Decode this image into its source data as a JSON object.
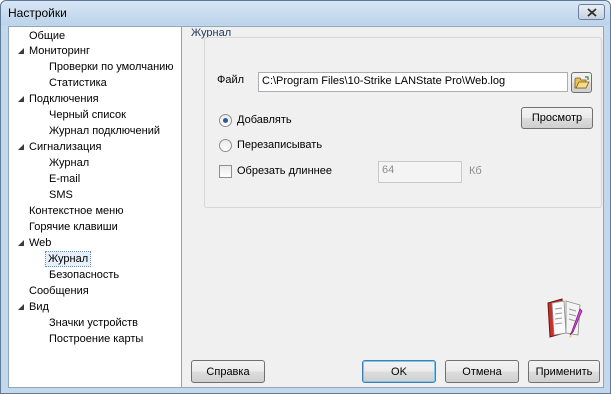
{
  "window": {
    "title": "Настройки"
  },
  "tree": {
    "items": [
      {
        "label": "Общие"
      },
      {
        "label": "Мониторинг"
      },
      {
        "label": "Проверки по умолчанию"
      },
      {
        "label": "Статистика"
      },
      {
        "label": "Подключения"
      },
      {
        "label": "Черный список"
      },
      {
        "label": "Журнал подключений"
      },
      {
        "label": "Сигнализация"
      },
      {
        "label": "Журнал"
      },
      {
        "label": "E-mail"
      },
      {
        "label": "SMS"
      },
      {
        "label": "Контекстное меню"
      },
      {
        "label": "Горячие клавиши"
      },
      {
        "label": "Web"
      },
      {
        "label": "Журнал"
      },
      {
        "label": "Безопасность"
      },
      {
        "label": "Сообщения"
      },
      {
        "label": "Вид"
      },
      {
        "label": "Значки устройств"
      },
      {
        "label": "Построение карты"
      }
    ]
  },
  "panel": {
    "title": "Журнал",
    "file_label": "Файл",
    "file_value": "C:\\Program Files\\10-Strike LANState Pro\\Web.log",
    "append_label": "Добавлять",
    "overwrite_label": "Перезаписывать",
    "truncate_label": "Обрезать длиннее",
    "truncate_value": "64",
    "truncate_unit": "Кб",
    "view_button": "Просмотр",
    "selected_mode": "append",
    "truncate_checked": false
  },
  "footer": {
    "help_button": "Справка",
    "ok_button": "OK",
    "cancel_button": "Отмена",
    "apply_button": "Применить"
  }
}
